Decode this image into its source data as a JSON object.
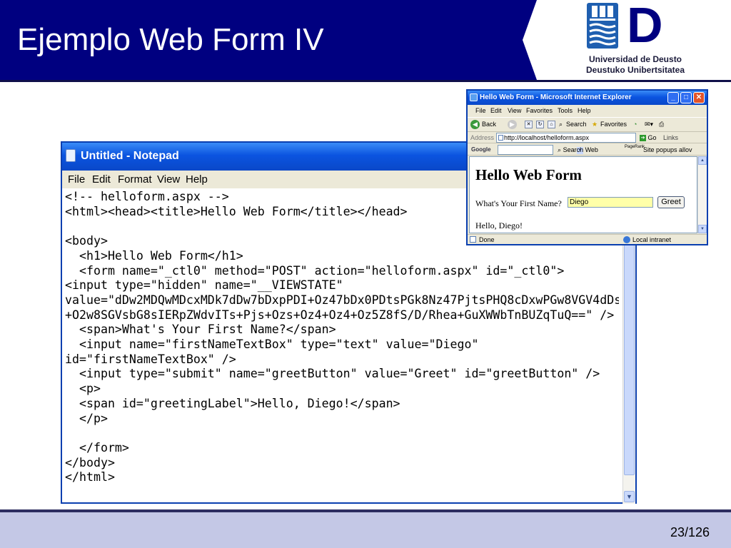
{
  "slide": {
    "title": "Ejemplo Web Form IV",
    "page_number": "23/126",
    "colors": {
      "header_band": "#000080",
      "footer": "#c4c8e6",
      "xp_title": "#0b54e0"
    }
  },
  "logo": {
    "letter": "D",
    "line1": "Universidad de Deusto",
    "line2": "Deustuko Unibertsitatea"
  },
  "notepad": {
    "title": "Untitled - Notepad",
    "menu": [
      "File",
      "Edit",
      "Format",
      "View",
      "Help"
    ],
    "content": "<!-- helloform.aspx -->\n<html><head><title>Hello Web Form</title></head>\n\n<body>\n  <h1>Hello Web Form</h1>\n  <form name=\"_ctl0\" method=\"POST\" action=\"helloform.aspx\" id=\"_ctl0\">\n<input type=\"hidden\" name=\"__VIEWSTATE\"\nvalue=\"dDw2MDQwMDcxMDk7dDw7bDxpPDI+Oz47bDx0PDtsPGk8Nz47PjtsPHQ8cDxwPGw8VGV4dDs\n+O2w8SGVsbG8sIERpZWdvITs+Pjs+Ozs+Oz4+Oz4+Oz5Z8fS/D/Rhea+GuXWWbTnBUZqTuQ==\" />\n  <span>What's Your First Name?</span>\n  <input name=\"firstNameTextBox\" type=\"text\" value=\"Diego\"\nid=\"firstNameTextBox\" />\n  <input type=\"submit\" name=\"greetButton\" value=\"Greet\" id=\"greetButton\" />\n  <p>\n  <span id=\"greetingLabel\">Hello, Diego!</span>\n  </p>\n\n  </form>\n</body>\n</html>"
  },
  "ie": {
    "title": "Hello Web Form - Microsoft Internet Explorer",
    "menu": [
      "File",
      "Edit",
      "View",
      "Favorites",
      "Tools",
      "Help"
    ],
    "toolbar": {
      "back": "Back",
      "search": "Search",
      "favorites": "Favorites"
    },
    "address_label": "Address",
    "address": "http://localhost/helloform.aspx",
    "go": "Go",
    "links": "Links",
    "google_label": "Google",
    "search_web": "Search Web",
    "pagerank": "PageRank",
    "popups": "Site popups allov",
    "page": {
      "heading": "Hello Web Form",
      "prompt": "What's Your First Name?",
      "name_value": "Diego",
      "greet_button": "Greet",
      "greeting": "Hello, Diego!"
    },
    "status": "Done",
    "zone": "Local intranet"
  }
}
